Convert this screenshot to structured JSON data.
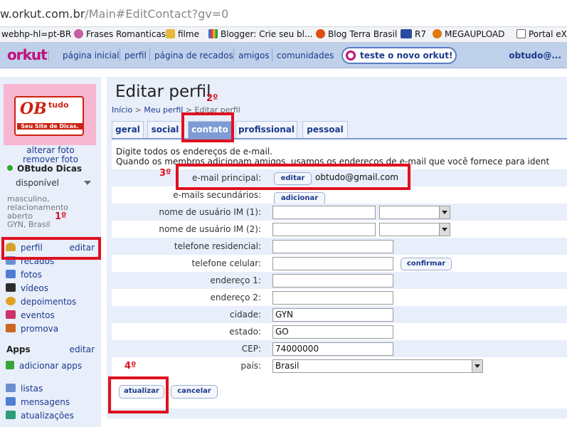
{
  "browser": {
    "url_host": "w.orkut.com.br",
    "url_path": "/Main#EditContact?gv=0"
  },
  "bookmarks": [
    {
      "label": "webhp-hl=pt-BR",
      "color": ""
    },
    {
      "label": "Frases Romanticas",
      "color": "#c45fa3"
    },
    {
      "label": "filme",
      "color": "#e6b83c"
    },
    {
      "label": "Blogger: Crie seu bl...",
      "color": "#3b6ed8"
    },
    {
      "label": "Blog Terra Brasil",
      "color": "#e04d10"
    },
    {
      "label": "R7",
      "color": "#2b4ca1"
    },
    {
      "label": "MEGAUPLOAD",
      "color": "#e07a10"
    },
    {
      "label": "Portal eXp",
      "color": "#666666"
    }
  ],
  "nav": {
    "logo": "orkut",
    "links": [
      "página inicial",
      "perfil",
      "página de recados",
      "amigos",
      "comunidades"
    ],
    "try_new": "teste o novo orkut!",
    "user": "obtudo@..."
  },
  "sidebar": {
    "logo": {
      "ob": "OB",
      "tudo": "tudo",
      "tagline": "Seu Site de Dicas."
    },
    "change_photo": "alterar foto",
    "remove_photo": "remover foto",
    "username": "OBtudo Dicas",
    "status": "disponível",
    "about": [
      "masculino,",
      "relacionamento",
      "aberto",
      "GYN, Brasil"
    ],
    "menu": [
      {
        "label": "perfil",
        "color": "#d6a12a"
      },
      {
        "label": "recados",
        "color": "#6b8fd0"
      },
      {
        "label": "fotos",
        "color": "#4f7ed0"
      },
      {
        "label": "vídeos",
        "color": "#2d2d2d"
      },
      {
        "label": "depoimentos",
        "color": "#e0a020"
      },
      {
        "label": "eventos",
        "color": "#cc3366"
      },
      {
        "label": "promova",
        "color": "#cc6622"
      }
    ],
    "edit": "editar",
    "apps_heading": "Apps",
    "apps_edit": "editar",
    "add_apps": "adicionar apps",
    "bottom_menu": [
      {
        "label": "listas",
        "color": "#6b8fd0"
      },
      {
        "label": "mensagens",
        "color": "#4f7ed0"
      },
      {
        "label": "atualizações",
        "color": "#2e9c7a"
      }
    ]
  },
  "page": {
    "title": "Editar perfil",
    "breadcrumb": {
      "home": "Início",
      "profile": "Meu perfil",
      "current": "Editar perfil",
      "sep": ">"
    },
    "tabs": [
      "geral",
      "social",
      "contato",
      "profissional",
      "pessoal"
    ],
    "active_tab": "contato",
    "intro_line1": "Digite todos os endereços de e-mail.",
    "intro_line2": "Quando os membros adicionam amigos, usamos os endereços de e-mail que você fornece para ident"
  },
  "form": {
    "primary_email_label": "e-mail principal:",
    "edit_button": "editar",
    "primary_email": "obtudo@gmail.com",
    "secondary_emails_label": "e-mails secundários:",
    "add_button": "adicionar",
    "im1_label": "nome de usuário IM (1):",
    "im1_value": "",
    "im2_label": "nome de usuário IM (2):",
    "im2_value": "",
    "home_phone_label": "telefone residencial:",
    "home_phone": "",
    "mobile_label": "telefone celular:",
    "mobile": "",
    "confirm_button": "confirmar",
    "address1_label": "endereço 1:",
    "address1": "",
    "address2_label": "endereço 2:",
    "address2": "",
    "city_label": "cidade:",
    "city": "GYN",
    "state_label": "estado:",
    "state": "GO",
    "zip_label": "CEP:",
    "zip": "74000000",
    "country_label": "país:",
    "country": "Brasil",
    "update_button": "atualizar",
    "cancel_button": "cancelar"
  },
  "annotations": {
    "step1": "1º",
    "step2": "2º",
    "step3": "3º",
    "step4": "4º",
    "color": "#e01020"
  }
}
